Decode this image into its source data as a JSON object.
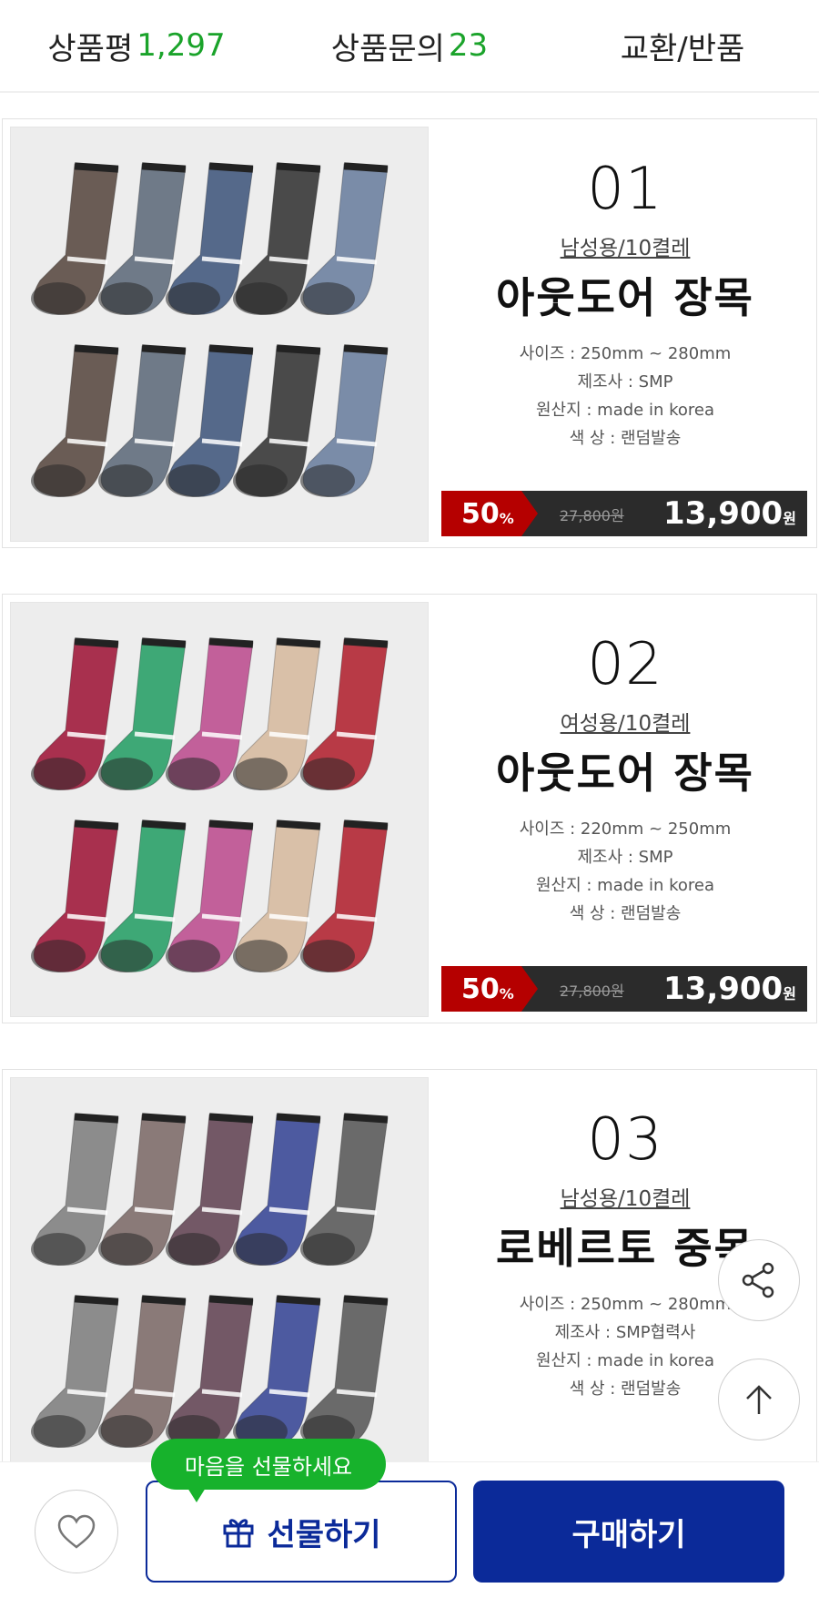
{
  "tabs": [
    {
      "label": "상품평",
      "count": "1,297"
    },
    {
      "label": "상품문의",
      "count": "23"
    },
    {
      "label": "교환/반품",
      "count": ""
    }
  ],
  "products": [
    {
      "number": "01",
      "category": "남성용/10켤레",
      "name": "아웃도어 장목",
      "specs": [
        "사이즈 : 250mm ~ 280mm",
        "제조사 : SMP",
        "원산지 : made in korea",
        "색   상 : 랜덤발송"
      ],
      "discount": "50",
      "discount_unit": "%",
      "old_price": "27,800원",
      "price": "13,900",
      "price_unit": "원",
      "sock_colors": [
        "#6a5c55",
        "#6f7a88",
        "#55698a",
        "#4a4a4a",
        "#7a8ca8"
      ]
    },
    {
      "number": "02",
      "category": "여성용/10켤레",
      "name": "아웃도어 장목",
      "specs": [
        "사이즈 : 220mm ~ 250mm",
        "제조사 : SMP",
        "원산지 : made in korea",
        "색   상 : 랜덤발송"
      ],
      "discount": "50",
      "discount_unit": "%",
      "old_price": "27,800원",
      "price": "13,900",
      "price_unit": "원",
      "sock_colors": [
        "#a8304e",
        "#3ea876",
        "#c2609a",
        "#d9c0a8",
        "#b83a46"
      ]
    },
    {
      "number": "03",
      "category": "남성용/10켤레",
      "name": "로베르토 중목",
      "specs": [
        "사이즈 : 250mm ~ 280mm",
        "제조사 : SMP협력사",
        "원산지 : made in korea",
        "색   상 : 랜덤발송"
      ],
      "sock_colors": [
        "#8c8c8c",
        "#8a7a78",
        "#735866",
        "#4d5aa0",
        "#6a6a6a"
      ]
    }
  ],
  "icons": {
    "share": "share-icon",
    "top": "arrow-up-icon",
    "wish": "heart-icon",
    "gift": "gift-icon"
  },
  "bottom": {
    "tooltip": "마음을 선물하세요",
    "gift_label": "선물하기",
    "buy_label": "구매하기"
  },
  "colors": {
    "accent_green": "#1aa32a",
    "discount_red": "#b50000",
    "buy_blue": "#0b2a99"
  }
}
